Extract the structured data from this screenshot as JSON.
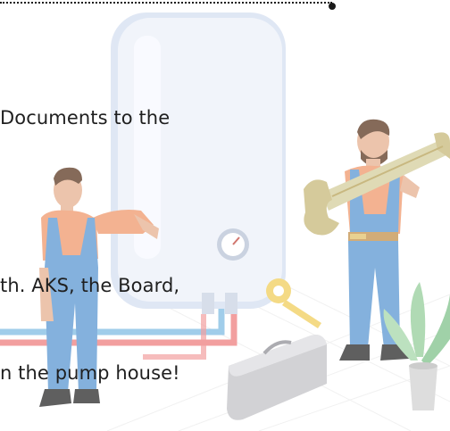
{
  "text_lines": [
    "Documents to the",
    "th. AKS, the Board,",
    "n the pump house!"
  ],
  "illustration": {
    "icons": [
      "water-heater-icon",
      "pressure-gauge-icon",
      "wrench-icon",
      "tape-measure-icon",
      "toolbox-icon",
      "potted-plant-icon"
    ],
    "colors": {
      "heater": "#e9eef8",
      "overalls": "#6aa1d6",
      "shirt": "#f1a27a",
      "wrench": "#d9d2a6",
      "hot_pipe": "#f08a8a",
      "cold_pipe": "#8cc3e6",
      "toolbox": "#c9c9cc",
      "plant": "#9fd3a4",
      "tape": "#f2d36b"
    }
  }
}
